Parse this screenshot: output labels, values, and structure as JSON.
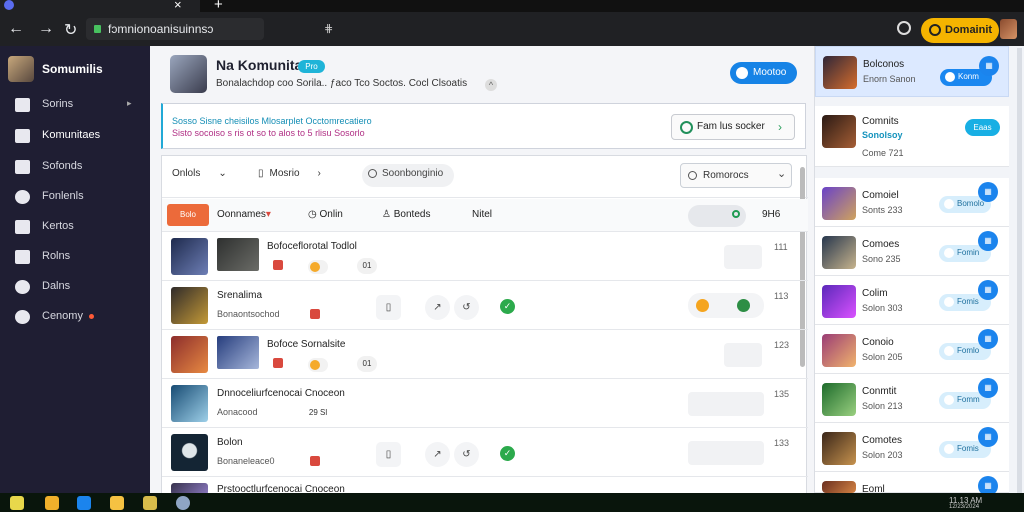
{
  "browser": {
    "tab_title": "",
    "address": "fɔmnionoanisuinnsɔ",
    "domain_button": "Domainit",
    "icons": [
      "back-icon",
      "forward-icon",
      "reload-icon",
      "lock-icon",
      "extension-icon",
      "profile-icon"
    ]
  },
  "sidebar": {
    "brand": "Somumilis",
    "items": [
      {
        "label": "Sorins",
        "icon": "home-icon",
        "has_chevron": true
      },
      {
        "label": "Komunitaes",
        "icon": "community-icon",
        "active": true
      },
      {
        "label": "Sofonds",
        "icon": "list-icon"
      },
      {
        "label": "Fonlenls",
        "icon": "gear-icon"
      },
      {
        "label": "Kertos",
        "icon": "tools-icon"
      },
      {
        "label": "Rolns",
        "icon": "house-icon"
      },
      {
        "label": "Dalns",
        "icon": "cloud-icon"
      },
      {
        "label": "Cenomy",
        "icon": "chat-icon",
        "badge_color": "#ff5a37"
      }
    ]
  },
  "header": {
    "title": "Na Komunitas",
    "badge": "Pro",
    "subtitle": "Bonalachdop coo Sorila..   ƒaco Tco Soctos.   Cocl   Clsoatis",
    "primary_action": "Mootoo"
  },
  "notice": {
    "line1": "Sosso Sisne cheisilos Mlosarplet Occtomrecatiero",
    "line2": "Sisto socoiso s ris ot so to alos to 5 rlisu Sosorlo",
    "action": "Fam lus socker"
  },
  "filters": {
    "first": "Onlols",
    "second": "Mosrio",
    "search": "Soonbonginio",
    "select": "Romorocs"
  },
  "tabs": {
    "active": "Bolo",
    "items": [
      "Oonnames",
      "Onlin",
      "Bonteds",
      "Nitel"
    ],
    "count": "9H6"
  },
  "rows": [
    {
      "title": "Bofoceflorotal Todlol",
      "meta": "",
      "chip": "01",
      "num": "111",
      "avatar_color": "#41516f",
      "thumb_color": "#41423f",
      "variant": "thumb"
    },
    {
      "title": "Srenalima",
      "meta": "Bonaontsochod",
      "chip": "",
      "num": "113",
      "avatar_color": "#9f7f38",
      "variant": "tools"
    },
    {
      "title": "Bofoce Sornalsite",
      "meta": "",
      "chip": "01",
      "num": "123",
      "avatar_color": "#e16f32",
      "thumb_color": "#4c6ab7",
      "variant": "thumb"
    },
    {
      "title": "Dnnoceliurfcenocai Cnoceon",
      "meta": "Aonacood",
      "chip": "29 Sl",
      "num": "135",
      "avatar_color": "#4e79b6",
      "variant": "plain"
    },
    {
      "title": "Bolon",
      "meta": "Bonaneleace0",
      "chip": "",
      "num": "133",
      "avatar_color": "#33465b",
      "variant": "tools"
    },
    {
      "title": "Prstooctlurfcenocai Cnoceon",
      "meta": "",
      "chip": "",
      "num": "",
      "avatar_color": "#624f8b",
      "variant": "partial"
    }
  ],
  "right_panel": {
    "top": {
      "title": "Bolconos",
      "sub": "Enorn Sanon",
      "button": "Konm",
      "avatar_color": "#d66d2d"
    },
    "follow": {
      "title": "Comnits",
      "sub": "Sonolsoy",
      "sub2": "Come 721",
      "button": "Eaas",
      "avatar_color": "#4f3525"
    },
    "items": [
      {
        "title": "Comoiel",
        "sub": "Sonts 233",
        "button": "Bomolo",
        "avatar_color": "#7c4abf"
      },
      {
        "title": "Comoes",
        "sub": "Sono 235",
        "button": "Fomin",
        "avatar_color": "#5f6f7f"
      },
      {
        "title": "Colim",
        "sub": "Solon 303",
        "button": "Fomis",
        "avatar_color": "#aa3ad1"
      },
      {
        "title": "Conoio",
        "sub": "Solon 205",
        "button": "Fomlo",
        "avatar_color": "#c45b90"
      },
      {
        "title": "Conmtit",
        "sub": "Solon 213",
        "button": "Fomm",
        "avatar_color": "#2a8f3f"
      },
      {
        "title": "Comotes",
        "sub": "Solon 203",
        "button": "Fomis",
        "avatar_color": "#5a3d2b"
      },
      {
        "title": "Eoml",
        "sub": "",
        "button": "",
        "avatar_color": "#a5522b"
      }
    ]
  },
  "taskbar": {
    "tray_time": "11.13 AM",
    "tray_date": "12/23/2024",
    "icons": [
      "start-icon",
      "edge-icon",
      "store-icon",
      "folder-icon",
      "shield-icon",
      "browser-icon"
    ]
  }
}
